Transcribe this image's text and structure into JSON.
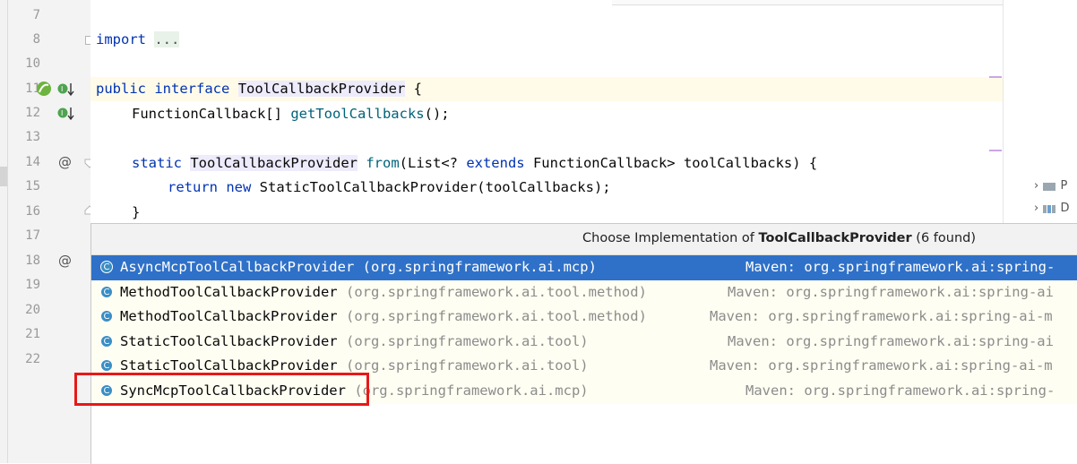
{
  "gutter": {
    "line_numbers": [
      "7",
      "8",
      "10",
      "11",
      "12",
      "13",
      "14",
      "15",
      "16",
      "17",
      "18",
      "19",
      "20",
      "21",
      "22"
    ]
  },
  "code": {
    "import_kw": "import",
    "import_fold": "...",
    "l11_kw1": "public",
    "l11_kw2": "interface",
    "l11_name": "ToolCallbackProvider",
    "l11_brace": " {",
    "l12_type": "FunctionCallback[] ",
    "l12_fn": "getToolCallbacks",
    "l12_rest": "();",
    "l14_kw": "static",
    "l14_type": "ToolCallbackProvider",
    "l14_fn": "from",
    "l14_rest1": "(List<? ",
    "l14_kw2": "extends",
    "l14_rest2": " FunctionCallback> toolCallbacks) {",
    "l15_kw1": "return",
    "l15_kw2": "new",
    "l15_rest": " StaticToolCallbackProvider(toolCallbacks);",
    "l16": "}"
  },
  "popup": {
    "title_prefix": "Choose Implementation of ",
    "title_bold": "ToolCallbackProvider",
    "title_suffix": " (6 found)",
    "items": [
      {
        "icon": "C",
        "name": "AsyncMcpToolCallbackProvider",
        "pkg": "(org.springframework.ai.mcp)",
        "maven": "Maven: org.springframework.ai:spring-"
      },
      {
        "icon": "C",
        "name": "MethodToolCallbackProvider",
        "pkg": "(org.springframework.ai.tool.method)",
        "maven": "Maven: org.springframework.ai:spring-ai"
      },
      {
        "icon": "C",
        "name": "MethodToolCallbackProvider",
        "pkg": "(org.springframework.ai.tool.method)",
        "maven": "Maven: org.springframework.ai:spring-ai-m"
      },
      {
        "icon": "C",
        "name": "StaticToolCallbackProvider",
        "pkg": "(org.springframework.ai.tool)",
        "maven": "Maven: org.springframework.ai:spring-ai"
      },
      {
        "icon": "C",
        "name": "StaticToolCallbackProvider",
        "pkg": "(org.springframework.ai.tool)",
        "maven": "Maven: org.springframework.ai:spring-ai-m"
      },
      {
        "icon": "C",
        "name": "SyncMcpToolCallbackProvider",
        "pkg": "(org.springframework.ai.mcp)",
        "maven": "Maven: org.springframework.ai:spring-"
      }
    ]
  },
  "right_panel": {
    "rows": [
      "P",
      "D"
    ]
  },
  "colors": {
    "selection": "#2f71c8",
    "highlight_box": "#e81818",
    "keyword": "#0033b3",
    "method": "#00627a"
  }
}
